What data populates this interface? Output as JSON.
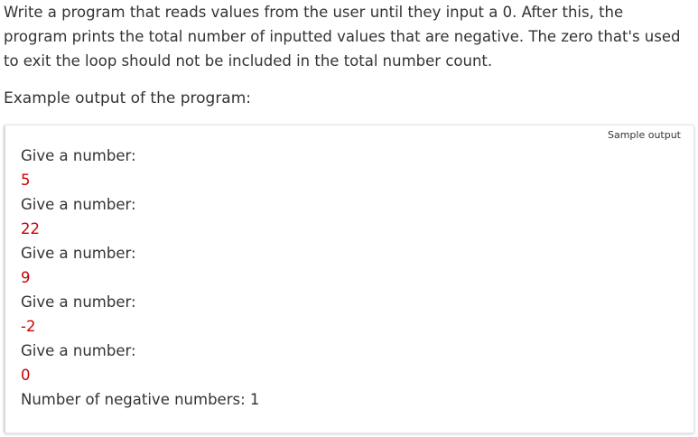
{
  "intro_text": "Write a program that reads values from the user until they input a 0. After this, the program prints the total number of inputted values that are negative. The zero that's used to exit the loop should not be included in the total number count.",
  "lead_text": "Example output of the program:",
  "sample": {
    "tag": "Sample output",
    "lines": [
      {
        "text": "Give a number:",
        "kind": "output"
      },
      {
        "text": "5",
        "kind": "input"
      },
      {
        "text": "Give a number:",
        "kind": "output"
      },
      {
        "text": "22",
        "kind": "input"
      },
      {
        "text": "Give a number:",
        "kind": "output"
      },
      {
        "text": "9",
        "kind": "input"
      },
      {
        "text": "Give a number:",
        "kind": "output"
      },
      {
        "text": "-2",
        "kind": "input"
      },
      {
        "text": "Give a number:",
        "kind": "output"
      },
      {
        "text": "0",
        "kind": "input"
      },
      {
        "text": "Number of negative numbers: 1",
        "kind": "output"
      }
    ]
  },
  "colors": {
    "input_text": "#cc0000",
    "body_text": "#333333"
  }
}
